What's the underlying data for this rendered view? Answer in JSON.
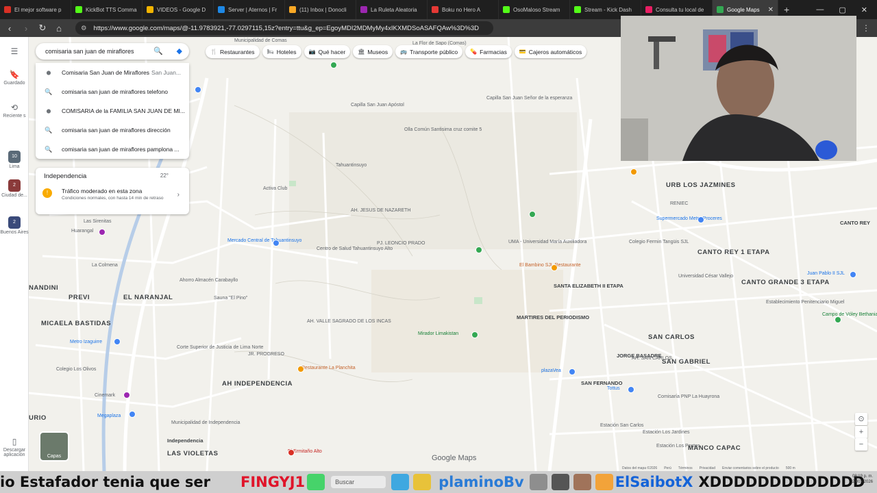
{
  "browser": {
    "tabs": [
      {
        "title": "El mejor software p",
        "color": "#d93025"
      },
      {
        "title": "KickBot TTS Comma",
        "color": "#53fc18"
      },
      {
        "title": "VIDEOS - Google D",
        "color": "#f4b400"
      },
      {
        "title": "Server | Aternos | Fr",
        "color": "#1e88e5"
      },
      {
        "title": "(11) Inbox | Donocli",
        "color": "#f9a825"
      },
      {
        "title": "La Ruleta Aleatoria",
        "color": "#9c27b0"
      },
      {
        "title": "Boku no Hero A",
        "color": "#e53935"
      },
      {
        "title": "OsoMaloso Stream",
        "color": "#53fc18"
      },
      {
        "title": "Stream - Kick Dash",
        "color": "#53fc18"
      },
      {
        "title": "Consulta tu local de",
        "color": "#e91e63"
      },
      {
        "title": "Google Maps",
        "color": "#34a853",
        "active": true
      }
    ],
    "new_tab": "+",
    "url": "https://www.google.com/maps/@-11.9783921,-77.0297115,15z?entry=ttu&g_ep=EgoyMDI2MDMyMy4xIKXMDSoASAFQAw%3D%3D"
  },
  "rail": {
    "saved": "Guardado",
    "recents": "Reciente s",
    "places": [
      {
        "label": "Lima",
        "badge": "10"
      },
      {
        "label": "Ciudad de...",
        "badge": "2"
      },
      {
        "label": "Buenos Aires",
        "badge": "2"
      }
    ],
    "download": "Descargar aplicación"
  },
  "search": {
    "value": "comisaria san juan de miraflores",
    "suggestions": [
      {
        "icon": "pin",
        "main": "Comisaria San Juan de Miraflores",
        "sub": "San Juan..."
      },
      {
        "icon": "search",
        "main": "comisaria san juan de miraflores telefono",
        "sub": ""
      },
      {
        "icon": "pin",
        "main": "COMISARIA de la FAMILIA SAN JUAN DE MI...",
        "sub": ""
      },
      {
        "icon": "search",
        "main": "comisaria san juan de miraflores dirección",
        "sub": ""
      },
      {
        "icon": "search",
        "main": "comisaria san juan de miraflores pamplona ...",
        "sub": ""
      }
    ]
  },
  "traffic": {
    "area": "Independencia",
    "temp": "22°",
    "title": "Tráfico moderado en esta zona",
    "detail": "Condiciones normales, con hasta 14 min de retraso"
  },
  "chips": [
    {
      "icon": "🍴",
      "label": "Restaurantes"
    },
    {
      "icon": "🛏",
      "label": "Hoteles"
    },
    {
      "icon": "📷",
      "label": "Qué hacer"
    },
    {
      "icon": "🏛",
      "label": "Museos"
    },
    {
      "icon": "🚌",
      "label": "Transporte público"
    },
    {
      "icon": "💊",
      "label": "Farmacias"
    },
    {
      "icon": "💳",
      "label": "Cajeros automáticos"
    }
  ],
  "map": {
    "labels": [
      {
        "t": "Municipalidad de Comas",
        "c": "",
        "s": ""
      },
      {
        "t": "La Flor de Sapo (Comas)",
        "c": "",
        "s": ""
      },
      {
        "t": "Capilla San Juan Apóstol",
        "c": "",
        "s": ""
      },
      {
        "t": "Capilla San Juan Señor de la esperanza",
        "c": "",
        "s": ""
      },
      {
        "t": "Olla Común Santisima cruz comite 5",
        "c": "",
        "s": ""
      },
      {
        "t": "Tahuantinsuyo",
        "c": "",
        "s": ""
      },
      {
        "t": "Activa Club",
        "c": "",
        "s": ""
      },
      {
        "t": "AH. JESUS DE NAZARETH",
        "c": "",
        "s": ""
      },
      {
        "t": "Mercado Central de Tahuantinsuyo",
        "c": "blue",
        "s": ""
      },
      {
        "t": "Centro de Salud Tahuantinsuyo Alto",
        "c": "",
        "s": ""
      },
      {
        "t": "UMA - Universidad María Auxiliadora",
        "c": "",
        "s": ""
      },
      {
        "t": "El Bambino SJL Restaurante",
        "c": "orange",
        "s": ""
      },
      {
        "t": "SANTA ELIZABETH II ETAPA",
        "c": "",
        "s": "mid"
      },
      {
        "t": "URB LOS JAZMINES",
        "c": "",
        "s": "big"
      },
      {
        "t": "RENIEC",
        "c": "",
        "s": ""
      },
      {
        "t": "Supermercado Metro Proceres",
        "c": "blue",
        "s": ""
      },
      {
        "t": "CANTO REY 1 ETAPA",
        "c": "",
        "s": "big"
      },
      {
        "t": "CANTO REY",
        "c": "",
        "s": "mid"
      },
      {
        "t": "Colegio Fermin Tangüis SJL",
        "c": "",
        "s": ""
      },
      {
        "t": "Universidad César Vallejo",
        "c": "",
        "s": ""
      },
      {
        "t": "CANTO GRANDE 3 ETAPA",
        "c": "",
        "s": "big"
      },
      {
        "t": "Juan Pablo II SJL",
        "c": "blue",
        "s": ""
      },
      {
        "t": "Establecimiento Penitenciario Miguel",
        "c": "",
        "s": ""
      },
      {
        "t": "Campo de Vóley Bethania",
        "c": "green",
        "s": ""
      },
      {
        "t": "Las Sirenitas",
        "c": "",
        "s": ""
      },
      {
        "t": "Huarangal",
        "c": "",
        "s": ""
      },
      {
        "t": "La Colmena",
        "c": "",
        "s": ""
      },
      {
        "t": "Ahorro Almacén Carabayllo",
        "c": "",
        "s": ""
      },
      {
        "t": "Sauna \"El Pino\"",
        "c": "",
        "s": ""
      },
      {
        "t": "PREVI",
        "c": "",
        "s": "big"
      },
      {
        "t": "EL NARANJAL",
        "c": "",
        "s": "big"
      },
      {
        "t": "MICAELA BASTIDAS",
        "c": "",
        "s": "big"
      },
      {
        "t": "NANDINI",
        "c": "",
        "s": "big"
      },
      {
        "t": "Metro Izaguirre",
        "c": "blue",
        "s": ""
      },
      {
        "t": "Corte Superior de Justicia de Lima Norte",
        "c": "",
        "s": ""
      },
      {
        "t": "Colegio Los Olivos",
        "c": "",
        "s": ""
      },
      {
        "t": "Cinemark",
        "c": "",
        "s": ""
      },
      {
        "t": "Megaplaza",
        "c": "blue",
        "s": ""
      },
      {
        "t": "Municipalidad de Independencia",
        "c": "",
        "s": ""
      },
      {
        "t": "Independencia",
        "c": "",
        "s": "mid"
      },
      {
        "t": "LAS VIOLETAS",
        "c": "",
        "s": "big"
      },
      {
        "t": "AH INDEPENDENCIA",
        "c": "",
        "s": "big"
      },
      {
        "t": "Restaurante La Planchita",
        "c": "orange",
        "s": ""
      },
      {
        "t": "El Ermitaño Alto",
        "c": "red",
        "s": ""
      },
      {
        "t": "Mirador Limakistan",
        "c": "green",
        "s": ""
      },
      {
        "t": "MARTIRES DEL PERIODISMO",
        "c": "",
        "s": "mid"
      },
      {
        "t": "SAN CARLOS",
        "c": "",
        "s": "big"
      },
      {
        "t": "JORGE BASADRE",
        "c": "",
        "s": "mid"
      },
      {
        "t": "SAN GABRIEL",
        "c": "",
        "s": "big"
      },
      {
        "t": "SAN FERNANDO",
        "c": "",
        "s": "mid"
      },
      {
        "t": "plazaVea",
        "c": "blue",
        "s": ""
      },
      {
        "t": "Tottus",
        "c": "blue",
        "s": ""
      },
      {
        "t": "Comisaría PNP La Huayrona",
        "c": "",
        "s": ""
      },
      {
        "t": "Estación San Carlos",
        "c": "",
        "s": ""
      },
      {
        "t": "Estación Los Jardines",
        "c": "",
        "s": ""
      },
      {
        "t": "Estación Los Postes",
        "c": "",
        "s": ""
      },
      {
        "t": "MANCO CAPAC",
        "c": "",
        "s": "big"
      },
      {
        "t": "AH. SAN CARLOS",
        "c": "",
        "s": ""
      },
      {
        "t": "AH. VALLE SAGRADO DE LOS INCAS",
        "c": "",
        "s": ""
      },
      {
        "t": "URIO",
        "c": "",
        "s": "big"
      },
      {
        "t": "JR. PROGRESO",
        "c": "",
        "s": ""
      },
      {
        "t": "PJ. LEONCIO PRADO",
        "c": "",
        "s": ""
      }
    ],
    "layers_label": "Capas",
    "logo": "Google Maps",
    "footer": [
      "Datos del mapa ©2026",
      "Perú",
      "Términos",
      "Privacidad",
      "Enviar comentarios sobre el producto",
      "500 m"
    ]
  },
  "overlay": {
    "text1": "io Estafador tenia que ser",
    "name1": "FINGYJ1",
    "search_placeholder": "Buscar",
    "name2": "plaminoBv",
    "name3": "ElSaibotX",
    "text2": "XDDDDDDDDDDDDD",
    "clock_time": "08:19 p. m.",
    "clock_date": "26/03/2026"
  }
}
